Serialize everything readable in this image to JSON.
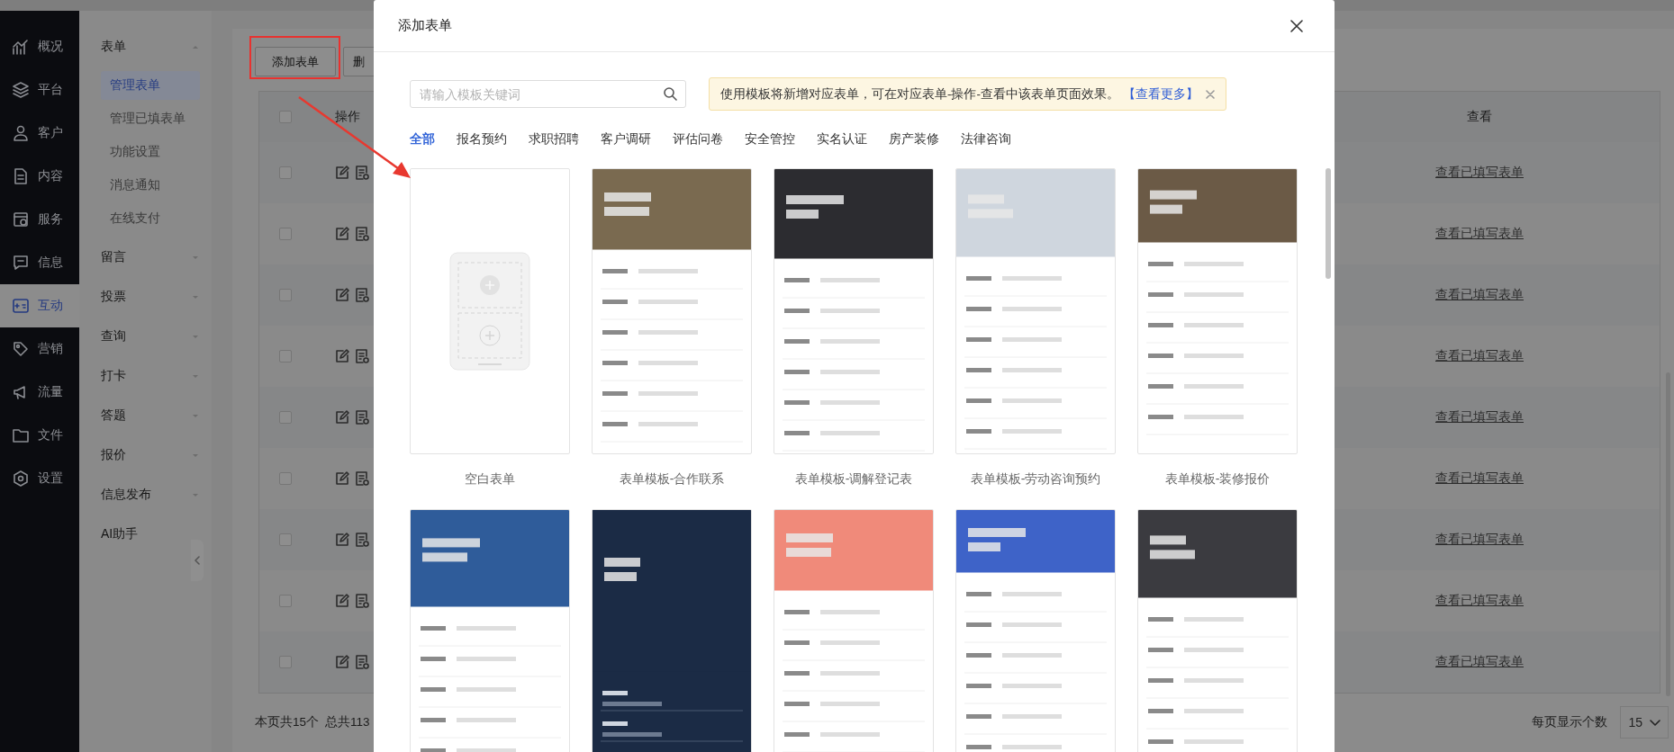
{
  "nav": {
    "items": [
      {
        "label": "概况",
        "selected": false
      },
      {
        "label": "平台",
        "selected": false
      },
      {
        "label": "客户",
        "selected": false
      },
      {
        "label": "内容",
        "selected": false
      },
      {
        "label": "服务",
        "selected": false
      },
      {
        "label": "信息",
        "selected": false
      },
      {
        "label": "互动",
        "selected": true
      },
      {
        "label": "营销",
        "selected": false
      },
      {
        "label": "流量",
        "selected": false
      },
      {
        "label": "文件",
        "selected": false
      },
      {
        "label": "设置",
        "selected": false
      }
    ]
  },
  "submenu": {
    "groups": [
      {
        "label": "表单",
        "expanded": true,
        "children": [
          {
            "label": "管理表单",
            "selected": true
          },
          {
            "label": "管理已填表单",
            "selected": false
          },
          {
            "label": "功能设置",
            "selected": false
          },
          {
            "label": "消息通知",
            "selected": false
          },
          {
            "label": "在线支付",
            "selected": false
          }
        ]
      },
      {
        "label": "留言",
        "expanded": false
      },
      {
        "label": "投票",
        "expanded": false
      },
      {
        "label": "查询",
        "expanded": false
      },
      {
        "label": "打卡",
        "expanded": false
      },
      {
        "label": "答题",
        "expanded": false
      },
      {
        "label": "报价",
        "expanded": false
      },
      {
        "label": "信息发布",
        "expanded": false
      },
      {
        "label": "AI助手"
      }
    ]
  },
  "toolbar": {
    "buttons": [
      {
        "label": "添加表单",
        "highlighted": true
      },
      {
        "label": "删"
      }
    ]
  },
  "table": {
    "select_all_checked": false,
    "columns": [
      "操作",
      "查看"
    ],
    "rows": [
      {
        "checked": false,
        "view_link": "查看已填写表单"
      },
      {
        "checked": false,
        "view_link": "查看已填写表单"
      },
      {
        "checked": false,
        "view_link": "查看已填写表单"
      },
      {
        "checked": false,
        "view_link": "查看已填写表单"
      },
      {
        "checked": false,
        "view_link": "查看已填写表单"
      },
      {
        "checked": false,
        "view_link": "查看已填写表单"
      },
      {
        "checked": false,
        "view_link": "查看已填写表单"
      },
      {
        "checked": false,
        "view_link": "查看已填写表单"
      },
      {
        "checked": false,
        "view_link": "查看已填写表单"
      }
    ]
  },
  "pagination": {
    "page_count": "本页共15个",
    "total": "总共113",
    "page_size_label": "每页显示个数",
    "page_size": "15"
  },
  "dialog": {
    "title": "添加表单",
    "search": {
      "placeholder": "请输入模板关键词"
    },
    "notice": {
      "text": "使用模板将新增对应表单，可在对应表单-操作-查看中该表单页面效果。",
      "link": "【查看更多】"
    },
    "tabs": [
      {
        "label": "全部",
        "selected": true
      },
      {
        "label": "报名预约",
        "selected": false
      },
      {
        "label": "求职招聘",
        "selected": false
      },
      {
        "label": "客户调研",
        "selected": false
      },
      {
        "label": "评估问卷",
        "selected": false
      },
      {
        "label": "安全管控",
        "selected": false
      },
      {
        "label": "实名认证",
        "selected": false
      },
      {
        "label": "房产装修",
        "selected": false
      },
      {
        "label": "法律咨询",
        "selected": false
      }
    ],
    "templates": [
      {
        "kind": "blank",
        "name": "空白表单"
      },
      {
        "kind": "template",
        "name": "表单模板-合作联系"
      },
      {
        "kind": "template",
        "name": "表单模板-调解登记表"
      },
      {
        "kind": "template",
        "name": "表单模板-劳动咨询预约"
      },
      {
        "kind": "template",
        "name": "表单模板-装修报价"
      },
      {
        "kind": "template"
      },
      {
        "kind": "template"
      },
      {
        "kind": "template"
      },
      {
        "kind": "template"
      },
      {
        "kind": "template"
      }
    ]
  }
}
